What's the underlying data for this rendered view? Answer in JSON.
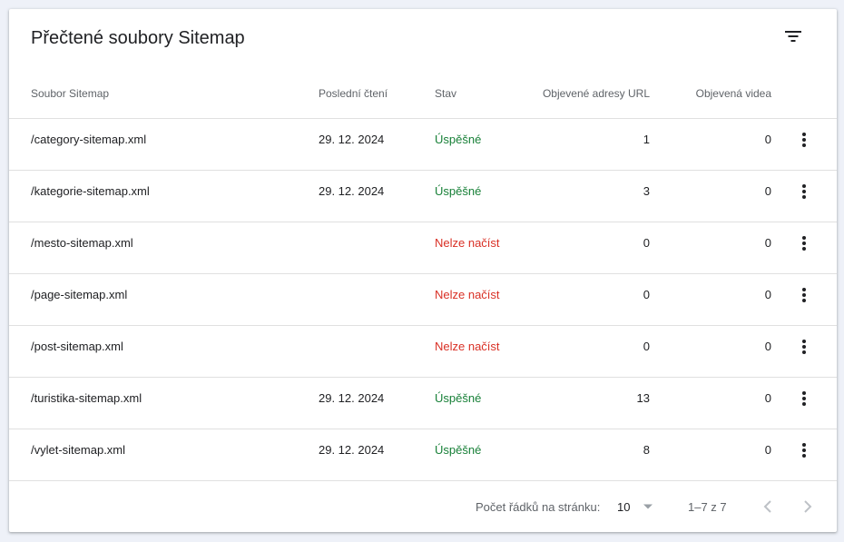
{
  "card": {
    "title": "Přečtené soubory Sitemap",
    "filter_icon": "filter-list-icon"
  },
  "table": {
    "columns": {
      "file": "Soubor Sitemap",
      "last_read": "Poslední čtení",
      "status": "Stav",
      "urls": "Objevené adresy URL",
      "videos": "Objevená videa"
    },
    "rows": [
      {
        "file": "/category-sitemap.xml",
        "last_read": "29. 12. 2024",
        "status": "Úspěšné",
        "status_kind": "ok",
        "urls": "1",
        "videos": "0"
      },
      {
        "file": "/kategorie-sitemap.xml",
        "last_read": "29. 12. 2024",
        "status": "Úspěšné",
        "status_kind": "ok",
        "urls": "3",
        "videos": "0"
      },
      {
        "file": "/mesto-sitemap.xml",
        "last_read": "",
        "status": "Nelze načíst",
        "status_kind": "err",
        "urls": "0",
        "videos": "0"
      },
      {
        "file": "/page-sitemap.xml",
        "last_read": "",
        "status": "Nelze načíst",
        "status_kind": "err",
        "urls": "0",
        "videos": "0"
      },
      {
        "file": "/post-sitemap.xml",
        "last_read": "",
        "status": "Nelze načíst",
        "status_kind": "err",
        "urls": "0",
        "videos": "0"
      },
      {
        "file": "/turistika-sitemap.xml",
        "last_read": "29. 12. 2024",
        "status": "Úspěšné",
        "status_kind": "ok",
        "urls": "13",
        "videos": "0"
      },
      {
        "file": "/vylet-sitemap.xml",
        "last_read": "29. 12. 2024",
        "status": "Úspěšné",
        "status_kind": "ok",
        "urls": "8",
        "videos": "0"
      }
    ],
    "row_menu_icon": "more-vert-icon"
  },
  "footer": {
    "rows_per_page_label": "Počet řádků na stránku:",
    "rows_per_page_value": "10",
    "page_range": "1–7 z 7",
    "prev_icon": "chevron-left-icon",
    "next_icon": "chevron-right-icon"
  },
  "colors": {
    "success": "#188038",
    "error": "#d93025",
    "text": "#202124",
    "secondary_text": "#5f6368",
    "divider": "#e0e0e0",
    "background": "#eef1f8"
  }
}
